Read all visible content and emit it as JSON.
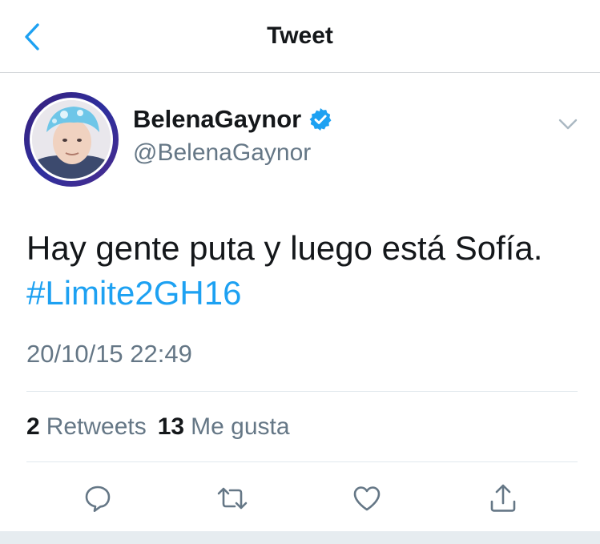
{
  "header": {
    "title": "Tweet",
    "back_icon": "chevron-left-icon"
  },
  "author": {
    "display_name": "BelenaGaynor",
    "handle": "@BelenaGaynor",
    "verified": true
  },
  "tweet": {
    "text": "Hay gente puta y luego está Sofía.",
    "hashtag": "#Limite2GH16",
    "timestamp": "20/10/15 22:49"
  },
  "stats": {
    "retweets_count": "2",
    "retweets_label": "Retweets",
    "likes_count": "13",
    "likes_label": "Me gusta"
  },
  "actions": [
    "reply-icon",
    "retweet-icon",
    "like-icon",
    "share-icon"
  ],
  "colors": {
    "accent": "#1da1f2",
    "text": "#14171a",
    "secondary": "#657786",
    "divider": "#e1e8ed"
  }
}
